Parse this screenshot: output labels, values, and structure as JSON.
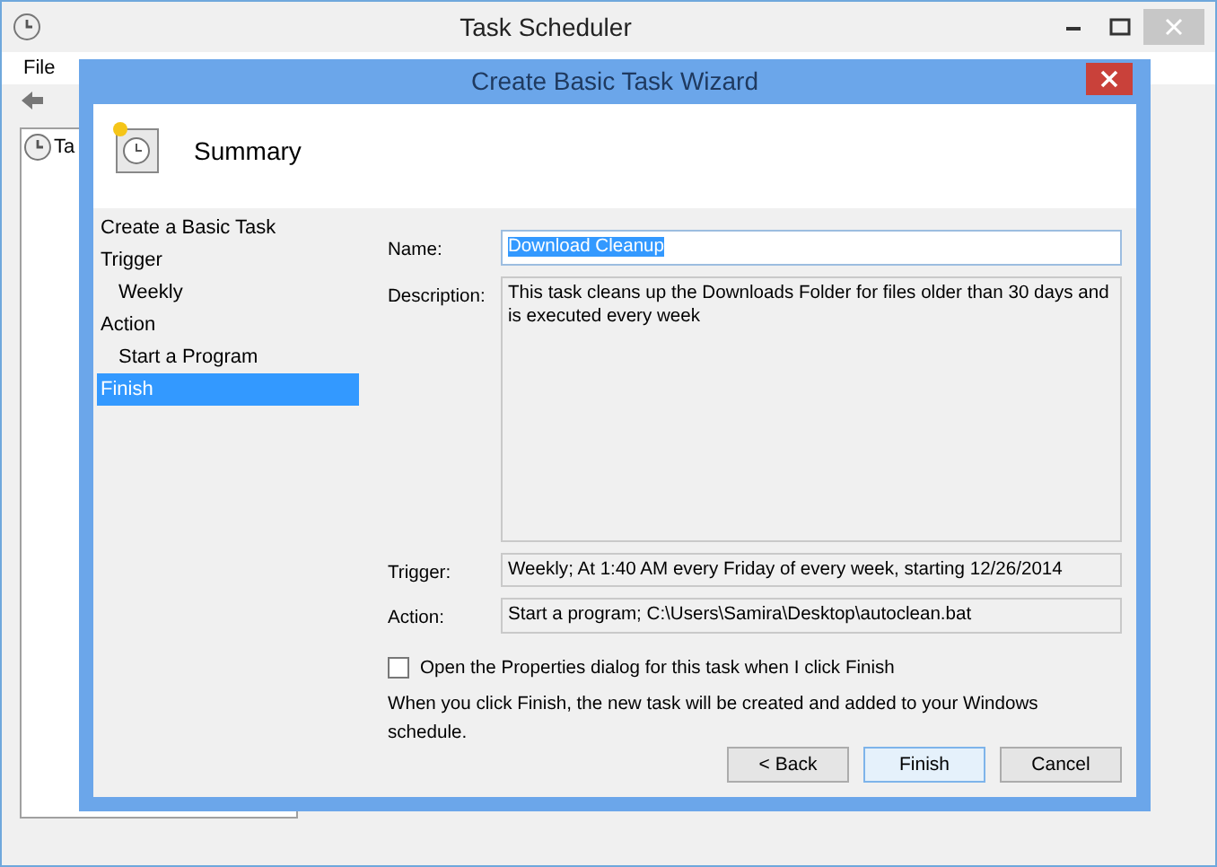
{
  "main_window": {
    "title": "Task Scheduler",
    "menu": [
      {
        "label": "File"
      }
    ],
    "tree": [
      {
        "label": "Ta"
      }
    ]
  },
  "wizard": {
    "title": "Create Basic Task Wizard",
    "heading": "Summary",
    "steps": [
      {
        "label": "Create a Basic Task",
        "selected": false
      },
      {
        "label": "Trigger",
        "selected": false,
        "children": [
          {
            "label": "Weekly",
            "selected": false
          }
        ]
      },
      {
        "label": "Action",
        "selected": false,
        "children": [
          {
            "label": "Start a Program",
            "selected": false
          }
        ]
      },
      {
        "label": "Finish",
        "selected": true
      }
    ],
    "fields": [
      {
        "kind": "line",
        "label": "Name:",
        "value": "Download Cleanup",
        "text_selected": true
      },
      {
        "kind": "area",
        "label": "Description:",
        "value": "This task cleans up the Downloads Folder for files older than 30 days and is executed every week"
      },
      {
        "kind": "line",
        "label": "Trigger:",
        "value": "Weekly; At 1:40 AM every Friday of every week, starting 12/26/2014",
        "text_selected": false
      },
      {
        "kind": "line",
        "label": "Action:",
        "value": "Start a program; C:\\Users\\Samira\\Desktop\\autoclean.bat",
        "text_selected": false
      }
    ],
    "checkbox": {
      "label": "Open the Properties dialog for this task when I click Finish",
      "checked": false
    },
    "note": "When you click Finish, the new task will be created and added to your Windows schedule.",
    "buttons": [
      {
        "label": "< Back",
        "default": false
      },
      {
        "label": "Finish",
        "default": true
      },
      {
        "label": "Cancel",
        "default": false
      }
    ]
  }
}
